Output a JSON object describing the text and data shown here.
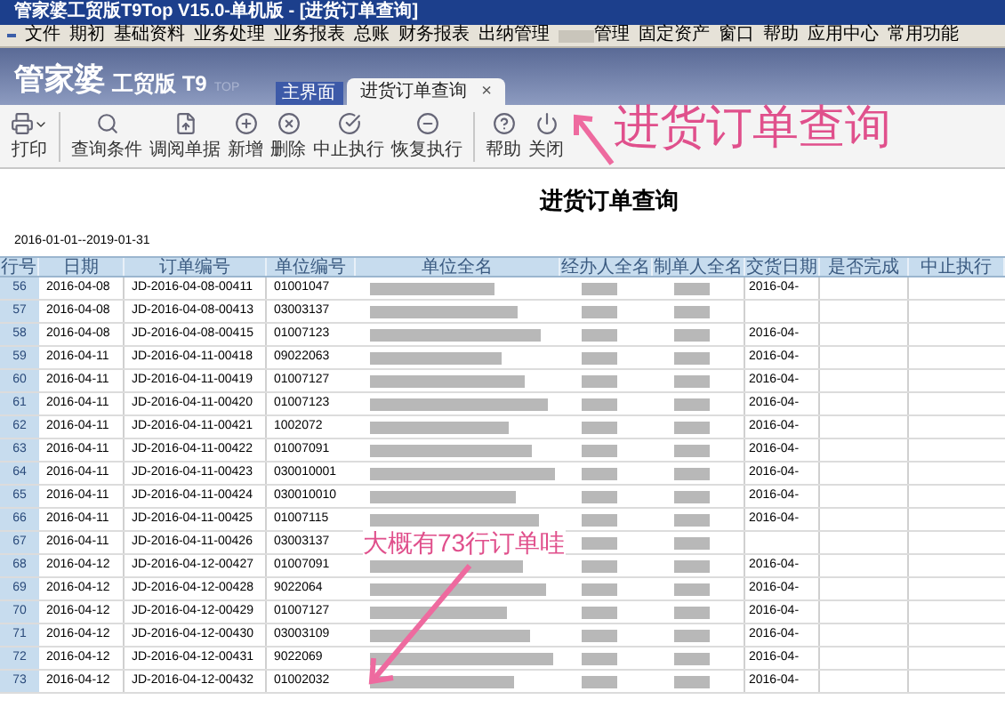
{
  "window": {
    "title": "管家婆工贸版T9Top V15.0-单机版 - [进货订单查询]"
  },
  "menu": [
    {
      "label": "文件",
      "blurred": false
    },
    {
      "label": "期初",
      "blurred": false
    },
    {
      "label": "基础资料",
      "blurred": false
    },
    {
      "label": "业务处理",
      "blurred": false
    },
    {
      "label": "业务报表",
      "blurred": false
    },
    {
      "label": "总账",
      "blurred": false
    },
    {
      "label": "财务报表",
      "blurred": false
    },
    {
      "label": "出纳管理",
      "blurred": false
    },
    {
      "label": "管理",
      "blurred": true
    },
    {
      "label": "固定资产",
      "blurred": false
    },
    {
      "label": "窗口",
      "blurred": false
    },
    {
      "label": "帮助",
      "blurred": false
    },
    {
      "label": "应用中心",
      "blurred": false
    },
    {
      "label": "常用功能",
      "blurred": false
    }
  ],
  "logo": {
    "name": "管家婆",
    "edition": "工贸版 T9",
    "tag": "TOP"
  },
  "tabs": [
    {
      "label": "主界面",
      "selected": false,
      "closable": false
    },
    {
      "label": "进货订单查询",
      "selected": true,
      "closable": true
    }
  ],
  "tab_close": "×",
  "toolbar": [
    {
      "label": "打印",
      "kind": "print"
    },
    {
      "label": "查询条件",
      "kind": "search"
    },
    {
      "label": "调阅单据",
      "kind": "open"
    },
    {
      "label": "新增",
      "kind": "add"
    },
    {
      "label": "删除",
      "kind": "delete"
    },
    {
      "label": "中止执行",
      "kind": "stop"
    },
    {
      "label": "恢复执行",
      "kind": "resume"
    },
    {
      "label": "帮助",
      "kind": "help"
    },
    {
      "label": "关闭",
      "kind": "close"
    }
  ],
  "page_title": "进货订单查询",
  "date_range": "2016-01-01--2019-01-31",
  "table": {
    "columns": [
      "行号",
      "日期",
      "订单编号",
      "单位编号",
      "单位全名",
      "经办人全名",
      "制单人全名",
      "交货日期",
      "是否完成",
      "中止执行"
    ],
    "rows": [
      {
        "no": "56",
        "date": "2016-04-08",
        "order": "JD-2016-04-08-00411",
        "unit": "01001047",
        "delivery": "2016-04-"
      },
      {
        "no": "57",
        "date": "2016-04-08",
        "order": "JD-2016-04-08-00413",
        "unit": "03003137"
      },
      {
        "no": "58",
        "date": "2016-04-08",
        "order": "JD-2016-04-08-00415",
        "unit": "01007123",
        "delivery": "2016-04-"
      },
      {
        "no": "59",
        "date": "2016-04-11",
        "order": "JD-2016-04-11-00418",
        "unit": "09022063",
        "delivery": "2016-04-"
      },
      {
        "no": "60",
        "date": "2016-04-11",
        "order": "JD-2016-04-11-00419",
        "unit": "01007127",
        "delivery": "2016-04-"
      },
      {
        "no": "61",
        "date": "2016-04-11",
        "order": "JD-2016-04-11-00420",
        "unit": "01007123",
        "delivery": "2016-04-"
      },
      {
        "no": "62",
        "date": "2016-04-11",
        "order": "JD-2016-04-11-00421",
        "unit": "1002072",
        "delivery": "2016-04-"
      },
      {
        "no": "63",
        "date": "2016-04-11",
        "order": "JD-2016-04-11-00422",
        "unit": "01007091",
        "delivery": "2016-04-"
      },
      {
        "no": "64",
        "date": "2016-04-11",
        "order": "JD-2016-04-11-00423",
        "unit": "030010001",
        "delivery": "2016-04-"
      },
      {
        "no": "65",
        "date": "2016-04-11",
        "order": "JD-2016-04-11-00424",
        "unit": "030010010",
        "delivery": "2016-04-"
      },
      {
        "no": "66",
        "date": "2016-04-11",
        "order": "JD-2016-04-11-00425",
        "unit": "01007115",
        "delivery": "2016-04-"
      },
      {
        "no": "67",
        "date": "2016-04-11",
        "order": "JD-2016-04-11-00426",
        "unit": "03003137"
      },
      {
        "no": "68",
        "date": "2016-04-12",
        "order": "JD-2016-04-12-00427",
        "unit": "01007091",
        "delivery": "2016-04-"
      },
      {
        "no": "69",
        "date": "2016-04-12",
        "order": "JD-2016-04-12-00428",
        "unit": "9022064",
        "delivery": "2016-04-"
      },
      {
        "no": "70",
        "date": "2016-04-12",
        "order": "JD-2016-04-12-00429",
        "unit": "01007127",
        "delivery": "2016-04-"
      },
      {
        "no": "71",
        "date": "2016-04-12",
        "order": "JD-2016-04-12-00430",
        "unit": "03003109",
        "delivery": "2016-04-"
      },
      {
        "no": "72",
        "date": "2016-04-12",
        "order": "JD-2016-04-12-00431",
        "unit": "9022069",
        "delivery": "2016-04-"
      },
      {
        "no": "73",
        "date": "2016-04-12",
        "order": "JD-2016-04-12-00432",
        "unit": "01002032",
        "delivery": "2016-04-"
      }
    ]
  },
  "annotations": [
    {
      "text": "进货订单查询",
      "kind": "title-note"
    },
    {
      "text": "大概有73行订单哇",
      "kind": "row-note"
    }
  ]
}
